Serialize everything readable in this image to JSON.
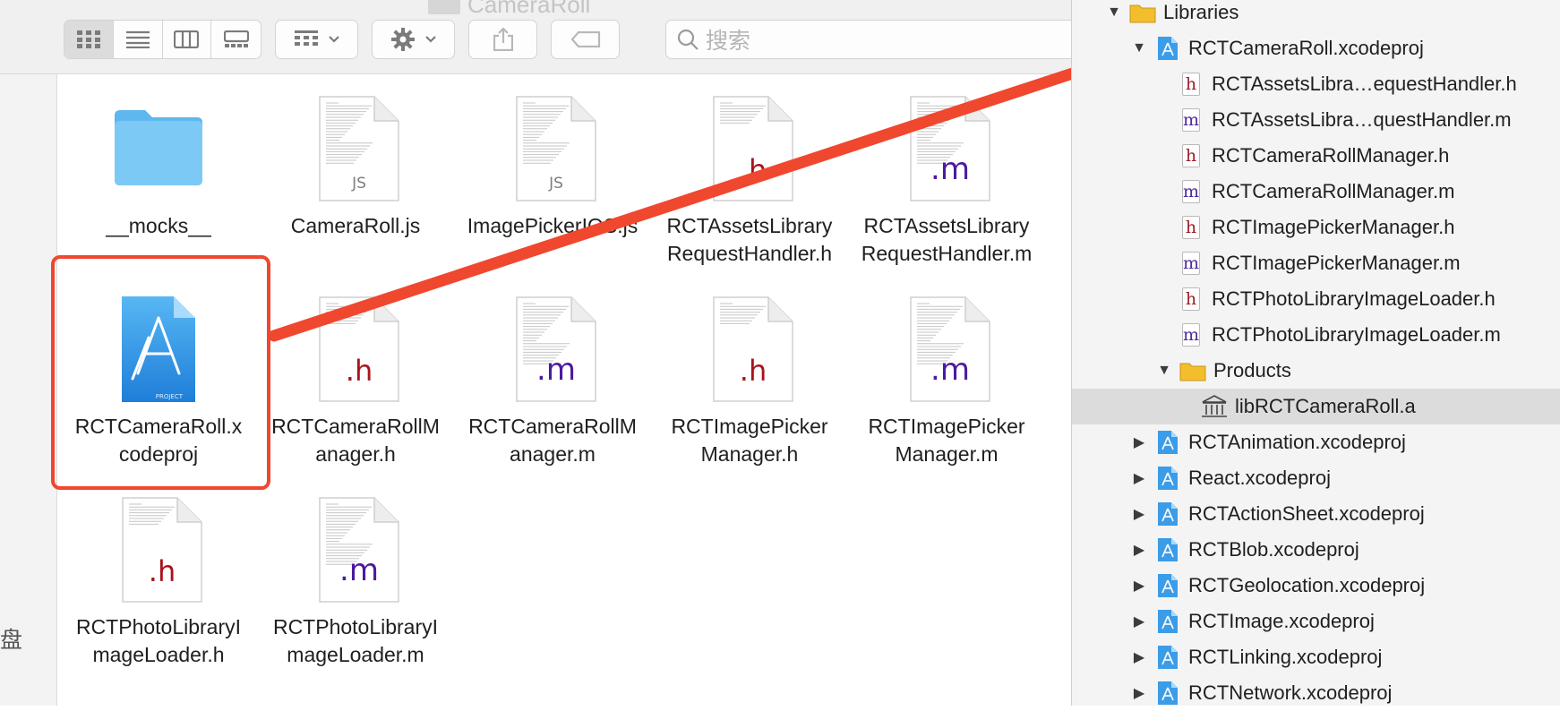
{
  "window": {
    "title": "CameraRoll"
  },
  "toolbar": {
    "view_modes": [
      "icon-view",
      "list-view",
      "column-view",
      "gallery-view"
    ],
    "active_view": "icon-view",
    "search_placeholder": "搜索"
  },
  "sidebar": {
    "partial_label": "盘"
  },
  "files": [
    {
      "name": "__mocks__",
      "kind": "folder"
    },
    {
      "name": "CameraRoll.js",
      "kind": "js",
      "ext": "JS"
    },
    {
      "name": "ImagePickerIOS.js",
      "kind": "js",
      "ext": "JS"
    },
    {
      "name": "RCTAssetsLibraryRequestHandler.h",
      "kind": "h",
      "ext": ".h"
    },
    {
      "name": "RCTAssetsLibraryRequestHandler.m",
      "kind": "m",
      "ext": ".m"
    },
    {
      "name": "RCTCameraRoll.xcodeproj",
      "kind": "xcodeproj",
      "selected": true
    },
    {
      "name": "RCTCameraRollManager.h",
      "kind": "h",
      "ext": ".h"
    },
    {
      "name": "RCTCameraRollManager.m",
      "kind": "m",
      "ext": ".m"
    },
    {
      "name": "RCTImagePickerManager.h",
      "kind": "h",
      "ext": ".h"
    },
    {
      "name": "RCTImagePickerManager.m",
      "kind": "m",
      "ext": ".m"
    },
    {
      "name": "RCTPhotoLibraryImageLoader.h",
      "kind": "h",
      "ext": ".h"
    },
    {
      "name": "RCTPhotoLibraryImageLoader.m",
      "kind": "m",
      "ext": ".m"
    }
  ],
  "file_labels": [
    [
      "__mocks__"
    ],
    [
      "CameraRoll.js"
    ],
    [
      "ImagePickerIOS.js"
    ],
    [
      "RCTAssetsLibrary",
      "RequestHandler.h"
    ],
    [
      "RCTAssetsLibrary",
      "RequestHandler.m"
    ],
    [
      "RCTCameraRoll.x",
      "codeproj"
    ],
    [
      "RCTCameraRollM",
      "anager.h"
    ],
    [
      "RCTCameraRollM",
      "anager.m"
    ],
    [
      "RCTImagePicker",
      "Manager.h"
    ],
    [
      "RCTImagePicker",
      "Manager.m"
    ],
    [
      "RCTPhotoLibraryI",
      "mageLoader.h"
    ],
    [
      "RCTPhotoLibraryI",
      "mageLoader.m"
    ]
  ],
  "project_icon_text": "PROJECT",
  "navigator": {
    "rows": [
      {
        "label": "Libraries",
        "type": "group",
        "expanded": true
      },
      {
        "label": "RCTCameraRoll.xcodeproj",
        "type": "project",
        "expanded": true
      },
      {
        "label": "RCTAssetsLibra…equestHandler.h",
        "type": "h"
      },
      {
        "label": "RCTAssetsLibra…questHandler.m",
        "type": "m"
      },
      {
        "label": "RCTCameraRollManager.h",
        "type": "h"
      },
      {
        "label": "RCTCameraRollManager.m",
        "type": "m"
      },
      {
        "label": "RCTImagePickerManager.h",
        "type": "h"
      },
      {
        "label": "RCTImagePickerManager.m",
        "type": "m"
      },
      {
        "label": "RCTPhotoLibraryImageLoader.h",
        "type": "h"
      },
      {
        "label": "RCTPhotoLibraryImageLoader.m",
        "type": "m"
      },
      {
        "label": "Products",
        "type": "group",
        "expanded": true
      },
      {
        "label": "libRCTCameraRoll.a",
        "type": "lib",
        "selected": true
      },
      {
        "label": "RCTAnimation.xcodeproj",
        "type": "project",
        "expanded": false
      },
      {
        "label": "React.xcodeproj",
        "type": "project",
        "expanded": false
      },
      {
        "label": "RCTActionSheet.xcodeproj",
        "type": "project",
        "expanded": false
      },
      {
        "label": "RCTBlob.xcodeproj",
        "type": "project",
        "expanded": false
      },
      {
        "label": "RCTGeolocation.xcodeproj",
        "type": "project",
        "expanded": false
      },
      {
        "label": "RCTImage.xcodeproj",
        "type": "project",
        "expanded": false
      },
      {
        "label": "RCTLinking.xcodeproj",
        "type": "project",
        "expanded": false
      },
      {
        "label": "RCTNetwork.xcodeproj",
        "type": "project",
        "expanded": false
      }
    ]
  },
  "colors": {
    "annotation_arrow": "#f0472f",
    "header_ext": "#a8141c",
    "impl_ext": "#4b1aa0",
    "folder_blue": "#74c6f4",
    "group_folder": "#f4c430"
  }
}
